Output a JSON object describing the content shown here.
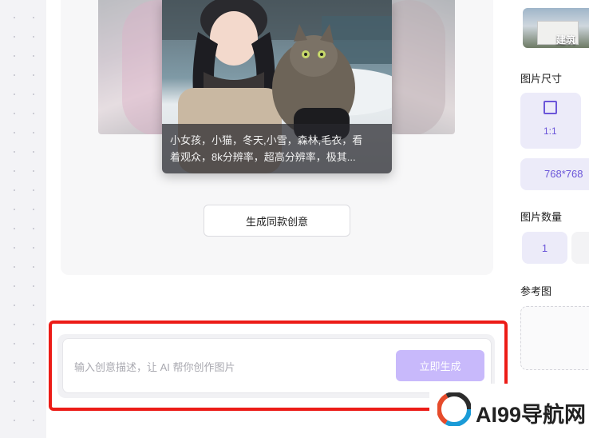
{
  "gallery": {
    "caption_line1": "小女孩，小猫，冬天,小雪，森林,毛衣，看",
    "caption_line2": "着观众，8k分辨率，超高分辨率，极其...",
    "same_button": "生成同款创意"
  },
  "prompt": {
    "placeholder": "输入创意描述，让 AI 帮你创作图片",
    "submit_label": "立即生成"
  },
  "settings": {
    "style_label": "建筑",
    "size_heading": "图片尺寸",
    "size_ratio": "1:1",
    "size_resolution": "768*768",
    "count_heading": "图片数量",
    "count_value": "1",
    "reference_heading": "参考图"
  },
  "watermark": {
    "text": "AI99导航网"
  },
  "colors": {
    "accent": "#6b56d9",
    "button_bg": "#c8b9fb",
    "highlight": "#ec1c17"
  }
}
